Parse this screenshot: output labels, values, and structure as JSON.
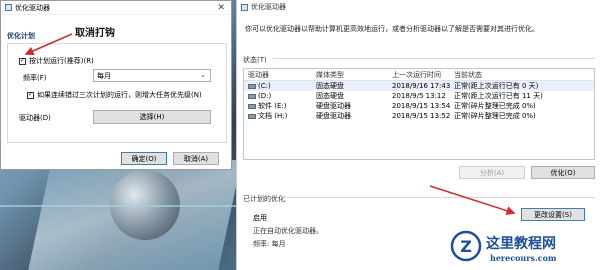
{
  "dialog": {
    "title": "优化驱动器",
    "close": "✕",
    "section": "优化计划",
    "run_scheduled": "按计划运行(推荐)(R)",
    "frequency_label": "频率(F)",
    "frequency_value": "每月",
    "missed_runs": "如果连续错过三次计划的运行，则增大任务优先级(N)",
    "drives_label": "驱动器(D)",
    "choose_button": "选择(H)",
    "ok_button": "确定(O)",
    "cancel_button": "取消(A)"
  },
  "annotation": "取消打钩",
  "main": {
    "title": "优化驱动器",
    "description": "你可以优化驱动器以帮助计算机更高效地运行，或者分析驱动器以了解是否需要对其进行优化。",
    "status_label": "状态(T)",
    "columns": [
      "驱动器",
      "媒体类型",
      "上一次运行时间",
      "当前状态"
    ],
    "drives": [
      {
        "name": "(C:)",
        "media": "固态硬盘",
        "last_run": "2018/9/16 17:43",
        "status": "正常(距上次运行已有 0 天)"
      },
      {
        "name": "(D:)",
        "media": "固态硬盘",
        "last_run": "2018/9/5 13:12",
        "status": "正常(距上次运行已有 11 天)"
      },
      {
        "name": "软件 (E:)",
        "media": "硬盘驱动器",
        "last_run": "2018/9/15 13:54",
        "status": "正常(碎片整理已完成 0%)"
      },
      {
        "name": "文档 (H:)",
        "media": "硬盘驱动器",
        "last_run": "2018/9/15 13:52",
        "status": "正常(碎片整理已完成 0%)"
      }
    ],
    "analyze_button": "分析(A)",
    "optimize_button": "优化(O)",
    "scheduled_label": "已计划的优化",
    "enabled": "启用",
    "auto_text": "正在自动优化驱动器。",
    "frequency": "频率: 每月",
    "change_settings": "更改设置(S)"
  },
  "watermark": {
    "cn": "这里教程网",
    "en": "herecours.com"
  },
  "colors": {
    "arrow": "#d12a2a",
    "link": "#1f3f7a",
    "watermark": "#1d4f9c"
  }
}
